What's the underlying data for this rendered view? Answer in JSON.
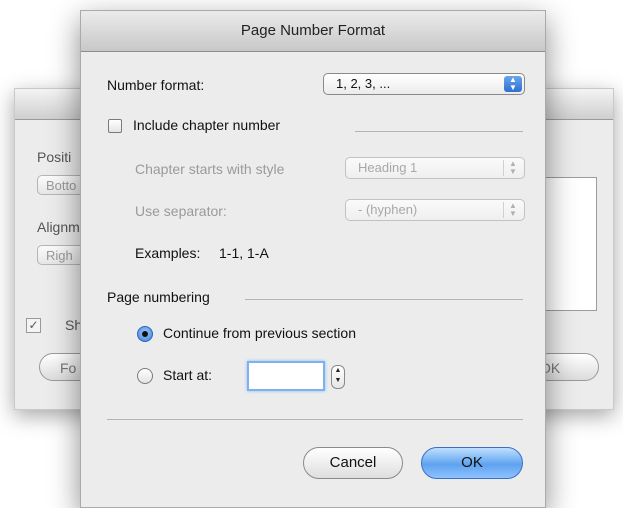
{
  "background_dialog": {
    "position_label": "Positi",
    "position_value": "Botto",
    "alignment_label": "Alignm",
    "alignment_value": "Righ",
    "show_label": "Sh",
    "format_button": "Fo",
    "ok_button": "OK"
  },
  "dialog": {
    "title": "Page Number Format",
    "number_format": {
      "label": "Number format:",
      "value": "1, 2, 3, ..."
    },
    "include_chapter": {
      "label": "Include chapter number",
      "checked": false
    },
    "chapter_style": {
      "label": "Chapter starts with style",
      "value": "Heading 1"
    },
    "separator": {
      "label": "Use separator:",
      "value": "-   (hyphen)"
    },
    "examples": {
      "label": "Examples:",
      "value": "1-1, 1-A"
    },
    "page_numbering": {
      "label": "Page numbering",
      "continue_label": "Continue from previous section",
      "continue_selected": true,
      "start_at_label": "Start at:",
      "start_at_value": ""
    },
    "buttons": {
      "cancel": "Cancel",
      "ok": "OK"
    }
  }
}
